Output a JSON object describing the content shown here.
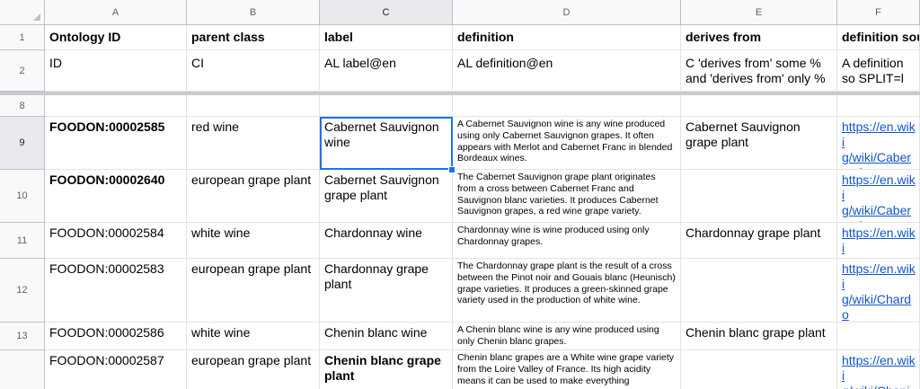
{
  "columns": [
    "A",
    "B",
    "C",
    "D",
    "E",
    "F"
  ],
  "rows": {
    "r1": {
      "num": "1",
      "a": "Ontology ID",
      "b": "parent class",
      "c": "label",
      "d": "definition",
      "e": "derives from",
      "f": "definition sou"
    },
    "r2": {
      "num": "2",
      "a": "ID",
      "b": "CI",
      "c": "AL label@en",
      "d": "AL definition@en",
      "e": "C 'derives from' some % and 'derives from' only %",
      "f": "A definition so SPLIT=l"
    },
    "r8": {
      "num": "8"
    },
    "r9": {
      "num": "9",
      "a": "FOODON:00002585",
      "b": "red wine",
      "c": "Cabernet Sauvignon wine",
      "d": "A Cabernet Sauvignon wine is any wine produced using only Cabernet Sauvignon grapes. It often appears with Merlot and Cabernet Franc in blended Bordeaux wines.",
      "e": "Cabernet Sauvignon grape plant",
      "f": "https://en.wiki g/wiki/Caberne ignon"
    },
    "r10": {
      "num": "10",
      "a": "FOODON:00002640",
      "b": "european grape plant",
      "c": "Cabernet Sauvignon grape plant",
      "d": "The Cabernet Sauvignon grape plant originates from a cross between Cabernet Franc and Sauvignon blanc varieties. It produces Cabernet Sauvignon grapes, a red wine grape variety.",
      "e": "",
      "f": "https://en.wiki g/wiki/Caberne ignon"
    },
    "r11": {
      "num": "11",
      "a": "FOODON:00002584",
      "b": "white wine",
      "c": "Chardonnay wine",
      "d": "Chardonnay wine is wine produced using only Chardonnay grapes.",
      "e": "Chardonnay grape plant",
      "f": "https://en.wiki g/wiki/Chardo"
    },
    "r12": {
      "num": "12",
      "a": "FOODON:00002583",
      "b": "european grape plant",
      "c": "Chardonnay grape plant",
      "d": "The Chardonnay grape plant is the result of a cross between the Pinot noir and Gouais blanc (Heunisch) grape varieties. It produces a green-skinned grape variety used in the production of white wine.",
      "e": "",
      "f": "https://en.wiki g/wiki/Chardo"
    },
    "r13": {
      "num": "13",
      "a": "FOODON:00002586",
      "b": "white wine",
      "c": "Chenin blanc wine",
      "d": "A Chenin blanc wine is any wine produced using only Chenin blanc grapes.",
      "e": "Chenin blanc grape plant",
      "f": ""
    },
    "r14": {
      "num": "",
      "a": "FOODON:00002587",
      "b": "european grape plant",
      "c": "Chenin blanc grape plant",
      "d": "Chenin blanc grapes are a White wine grape variety from the Loire Valley of France. Its high acidity means it can be used to make everything",
      "e": "",
      "f": "https://en.wiki g/wiki/Chenin"
    }
  },
  "colors": {
    "selection": "#1a73e8",
    "link": "#1155cc",
    "header_bg": "#f8f9fa"
  }
}
